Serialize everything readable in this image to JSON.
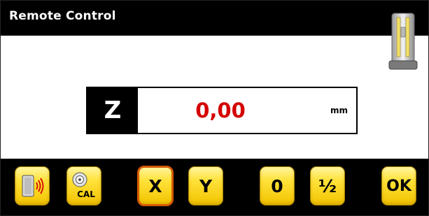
{
  "window": {
    "title": "Remote Control"
  },
  "display": {
    "axis": "Z",
    "value": "0,00",
    "unit": "mm",
    "value_color": "#d40000"
  },
  "toolbar": {
    "remote_icon": "wireless-remote-icon",
    "cal_label": "CAL",
    "x_label": "X",
    "y_label": "Y",
    "zero_label": "0",
    "half_label": "½",
    "ok_label": "OK"
  },
  "colors": {
    "button_yellow": "#ffe23a",
    "selected_outline": "#d45a00",
    "title_bg": "#000000"
  }
}
